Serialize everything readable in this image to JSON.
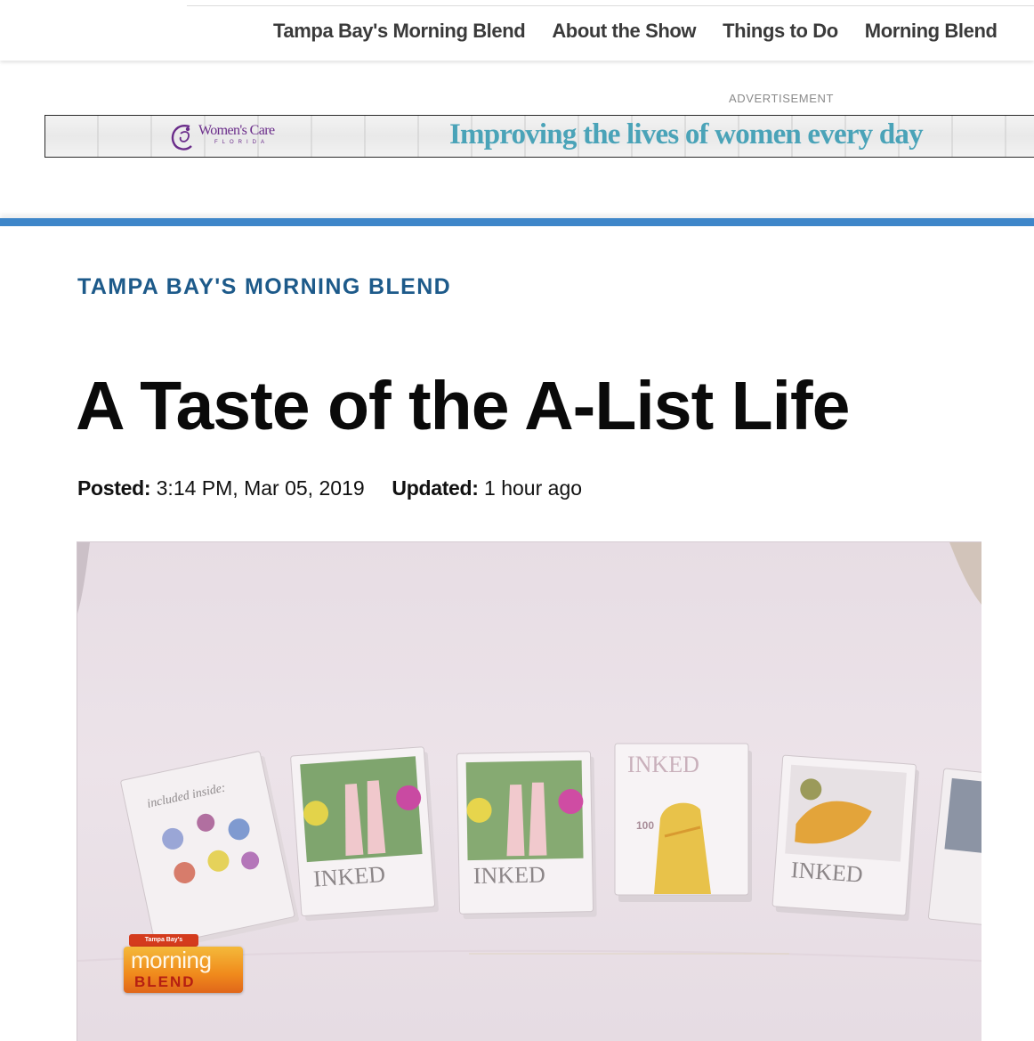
{
  "nav": {
    "items": [
      {
        "label": "Tampa Bay's Morning Blend"
      },
      {
        "label": "About the Show"
      },
      {
        "label": "Things to Do"
      },
      {
        "label": "Morning Blend"
      }
    ]
  },
  "ad": {
    "label": "ADVERTISEMENT",
    "brand": "Women's Care",
    "brand_sub": "FLORIDA",
    "tagline": "Improving the lives of women every day",
    "tagline_color": "#4aa3b8",
    "brand_color": "#6a2c8a"
  },
  "article": {
    "section": "TAMPA BAY'S MORNING BLEND",
    "section_color": "#1d5a8a",
    "title": "A Taste of the A-List Life",
    "posted_label": "Posted:",
    "posted_value": "3:14 PM, Mar 05, 2019",
    "updated_label": "Updated:",
    "updated_value": "1 hour ago"
  },
  "video": {
    "bug_small": "Tampa Bay's",
    "bug_word": "morning",
    "bug_word2": "BLEND",
    "card_text_1": "included inside:",
    "card_text_inked": "INKED",
    "card_text_100": "100"
  },
  "colors": {
    "divider": "#3e86c9",
    "nav_text": "#3a3a3a"
  }
}
